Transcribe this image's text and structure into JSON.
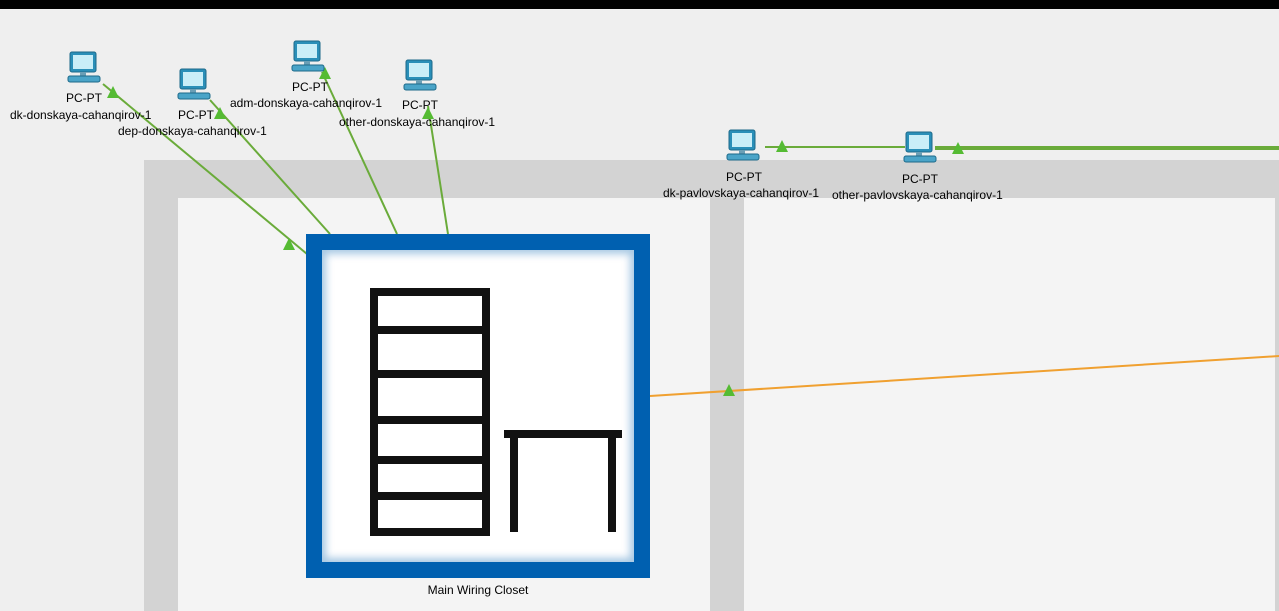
{
  "colors": {
    "copper_link": "#6aab3a",
    "fiber_link": "#f0a030",
    "link_up_marker": "#55bb33",
    "closet_frame": "#0060b0"
  },
  "devices": [
    {
      "type": "PC-PT",
      "name": "dk-donskaya-cahanqirov-1",
      "icon": "pc-icon"
    },
    {
      "type": "PC-PT",
      "name": "dep-donskaya-cahanqirov-1",
      "icon": "pc-icon"
    },
    {
      "type": "PC-PT",
      "name": "adm-donskaya-cahanqirov-1",
      "icon": "pc-icon"
    },
    {
      "type": "PC-PT",
      "name": "other-donskaya-cahanqirov-1",
      "icon": "pc-icon"
    },
    {
      "type": "PC-PT",
      "name": "dk-pavlovskaya-cahanqirov-1",
      "icon": "pc-icon"
    },
    {
      "type": "PC-PT",
      "name": "other-pavlovskaya-cahanqirov-1",
      "icon": "pc-icon"
    }
  ],
  "closet": {
    "label": "Main Wiring Closet",
    "icon": "wiring-closet-icon"
  }
}
